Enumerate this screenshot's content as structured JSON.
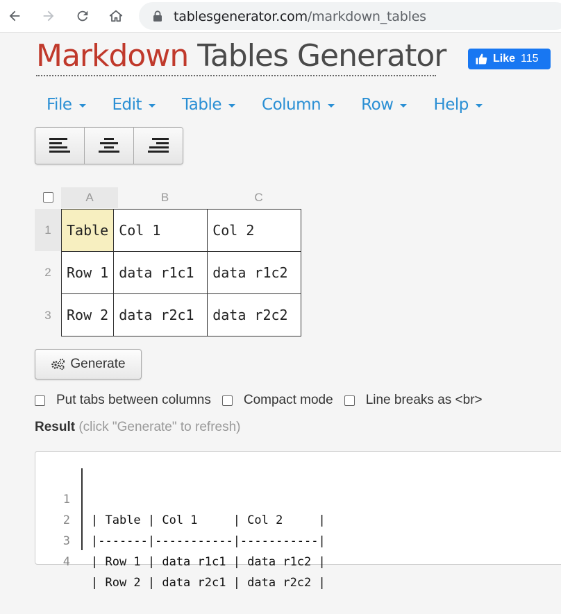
{
  "browser": {
    "url_domain": "tablesgenerator.com",
    "url_path": "/markdown_tables"
  },
  "header": {
    "title_part1": "Markdown",
    "title_part2": "Tables Generator",
    "like_label": "Like",
    "like_count": "115"
  },
  "menu": {
    "items": [
      {
        "label": "File"
      },
      {
        "label": "Edit"
      },
      {
        "label": "Table"
      },
      {
        "label": "Column"
      },
      {
        "label": "Row"
      },
      {
        "label": "Help"
      }
    ]
  },
  "toolbar": {
    "align_buttons": [
      "align-left-icon",
      "align-center-icon",
      "align-right-icon"
    ]
  },
  "sheet": {
    "column_headers": [
      "A",
      "B",
      "C"
    ],
    "row_headers": [
      "1",
      "2",
      "3"
    ],
    "rows": [
      [
        "Table",
        "Col 1",
        "Col 2"
      ],
      [
        "Row 1",
        "data r1c1",
        "data r1c2"
      ],
      [
        "Row 2",
        "data r2c1",
        "data r2c2"
      ]
    ],
    "selected_cell": "A1"
  },
  "actions": {
    "generate_label": "Generate"
  },
  "options": {
    "tabs_label": "Put tabs between columns",
    "compact_label": "Compact mode",
    "linebreaks_label": "Line breaks as <br>"
  },
  "result": {
    "label": "Result",
    "hint": "(click \"Generate\" to refresh)",
    "line_numbers": [
      "1",
      "2",
      "3",
      "4"
    ],
    "lines": [
      "| Table | Col 1     | Col 2     |",
      "|-------|-----------|-----------|",
      "| Row 1 | data r1c1 | data r1c2 |",
      "| Row 2 | data r2c1 | data r2c2 |"
    ]
  },
  "colors": {
    "accent_blue": "#2a8fd4",
    "title_red": "#c0392b",
    "facebook_blue": "#1877f2",
    "selected_cell": "#f7efc0"
  }
}
